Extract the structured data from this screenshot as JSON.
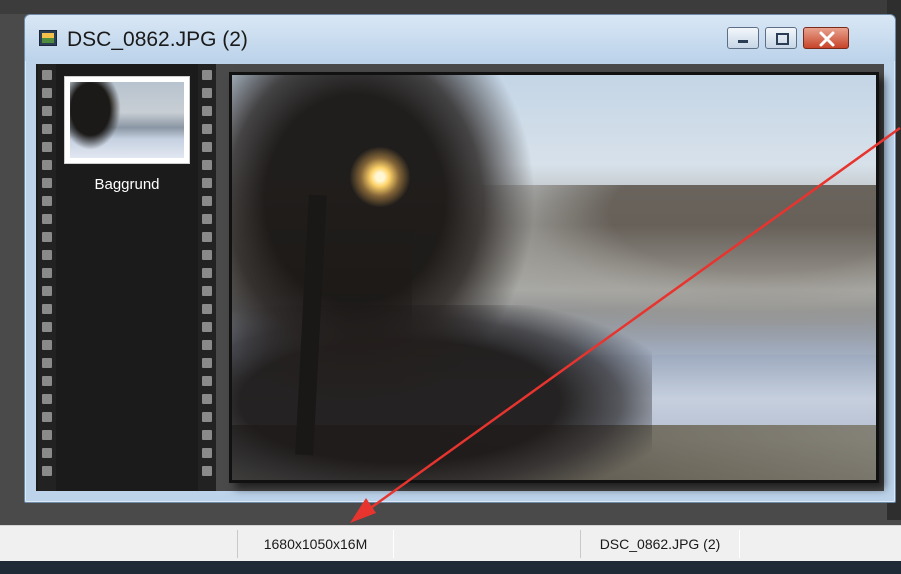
{
  "window": {
    "title": "DSC_0862.JPG (2)",
    "icon": "image-document-icon",
    "buttons": {
      "minimize": "minimize-icon",
      "maximize": "maximize-icon",
      "close": "close-icon"
    }
  },
  "layers": [
    {
      "label": "Baggrund"
    }
  ],
  "statusbar": {
    "dimensions": "1680x1050x16M",
    "filename": "DSC_0862.JPG (2)"
  },
  "annotation": {
    "arrow_color": "#e8342f"
  }
}
